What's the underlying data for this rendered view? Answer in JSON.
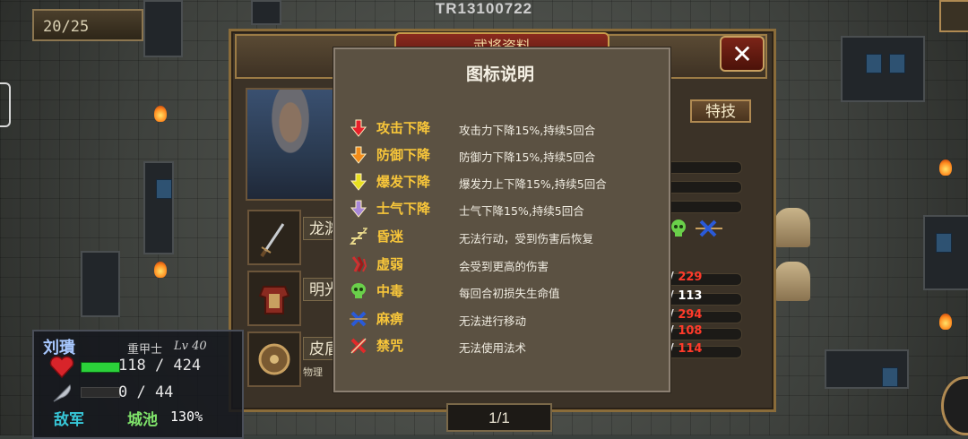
{
  "top": {
    "round_counter": "20/25",
    "stage_id": "TR13100722"
  },
  "panel": {
    "title": "武将资料",
    "close_label": "✕",
    "tab_special": "特技",
    "equipment": [
      {
        "name": "龙渊",
        "icon": "sword-icon"
      },
      {
        "name": "明光",
        "icon": "armor-icon"
      },
      {
        "name": "皮盾",
        "icon": "shield-icon",
        "desc": "物理"
      }
    ],
    "stats": [
      {
        "prefix": "0/",
        "value": "229",
        "color": "#ff3a2a"
      },
      {
        "prefix": "3/",
        "value": "113",
        "color": "#ffffff"
      },
      {
        "prefix": "5/",
        "value": "294",
        "color": "#ff3a2a"
      },
      {
        "prefix": "3/",
        "value": "108",
        "color": "#ff3a2a"
      },
      {
        "prefix": "5/",
        "value": "114",
        "color": "#ff3a2a"
      }
    ]
  },
  "legend": {
    "title": "图标说明",
    "rows": [
      {
        "icon": "red-down-arrow-icon",
        "name": "攻击下降",
        "desc": "攻击力下降15%,持续5回合",
        "color": "#e8202a"
      },
      {
        "icon": "orange-down-arrow-icon",
        "name": "防御下降",
        "desc": "防御力下降15%,持续5回合",
        "color": "#f28c1a"
      },
      {
        "icon": "yellow-down-arrow-icon",
        "name": "爆发下降",
        "desc": "爆发力上下降15%,持续5回合",
        "color": "#e8e020"
      },
      {
        "icon": "purple-down-arrow-icon",
        "name": "士气下降",
        "desc": "士气下降15%,持续5回合",
        "color": "#a888d8"
      },
      {
        "icon": "sleep-zz-icon",
        "name": "昏迷",
        "desc": "无法行动，受到伤害后恢复",
        "color": "#e8d88a"
      },
      {
        "icon": "weak-claw-icon",
        "name": "虚弱",
        "desc": "会受到更高的伤害",
        "color": "#d03030"
      },
      {
        "icon": "poison-skull-icon",
        "name": "中毒",
        "desc": "每回合初损失生命值",
        "color": "#6ad04a"
      },
      {
        "icon": "paralysis-x-icon",
        "name": "麻痹",
        "desc": "无法进行移动",
        "color": "#2a5ad8"
      },
      {
        "icon": "seal-x-icon",
        "name": "禁咒",
        "desc": "无法使用法术",
        "color": "#e02a2a"
      }
    ]
  },
  "pager": {
    "text": "1/1"
  },
  "unit": {
    "name": "刘璝",
    "class": "重甲士",
    "level": "Lv 40",
    "hp": "118 / 424",
    "hp_fraction": 0.28,
    "mp": "0 / 44",
    "faction": "敌军",
    "terrain": "城池",
    "terrain_pct": "130%"
  }
}
